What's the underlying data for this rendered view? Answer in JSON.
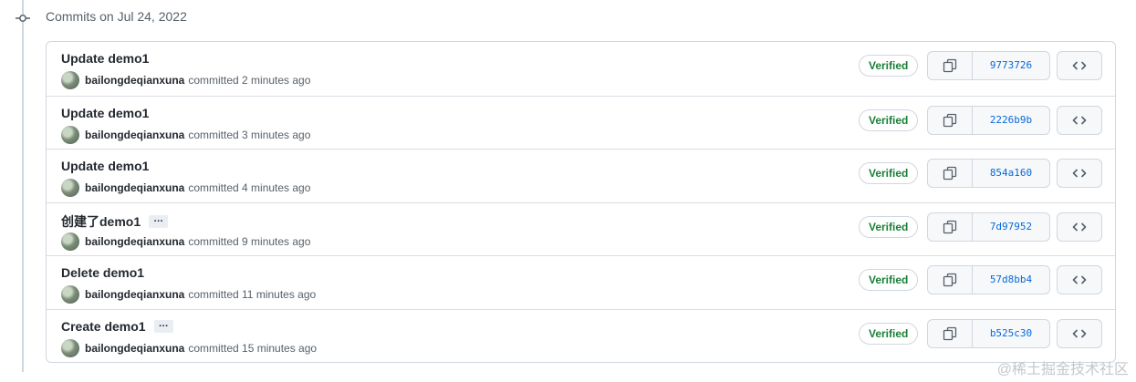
{
  "group_title": "Commits on Jul 24, 2022",
  "verified_label": "Verified",
  "commits": [
    {
      "message": "Update demo1",
      "author": "bailongdeqianxuna",
      "time": "committed 2 minutes ago",
      "sha": "9773726",
      "has_more": false
    },
    {
      "message": "Update demo1",
      "author": "bailongdeqianxuna",
      "time": "committed 3 minutes ago",
      "sha": "2226b9b",
      "has_more": false
    },
    {
      "message": "Update demo1",
      "author": "bailongdeqianxuna",
      "time": "committed 4 minutes ago",
      "sha": "854a160",
      "has_more": false
    },
    {
      "message": "创建了demo1",
      "author": "bailongdeqianxuna",
      "time": "committed 9 minutes ago",
      "sha": "7d97952",
      "has_more": true
    },
    {
      "message": "Delete demo1",
      "author": "bailongdeqianxuna",
      "time": "committed 11 minutes ago",
      "sha": "57d8bb4",
      "has_more": false
    },
    {
      "message": "Create demo1",
      "author": "bailongdeqianxuna",
      "time": "committed 15 minutes ago",
      "sha": "b525c30",
      "has_more": true
    }
  ],
  "ellipsis_label": "…",
  "watermark": "@稀土掘金技术社区",
  "icons": {
    "commit_node": "git-commit-icon",
    "copy": "copy-icon",
    "browse": "code-icon"
  },
  "colors": {
    "verified": "#1a7f37",
    "sha_link": "#0969da",
    "border": "#d0d7de"
  }
}
